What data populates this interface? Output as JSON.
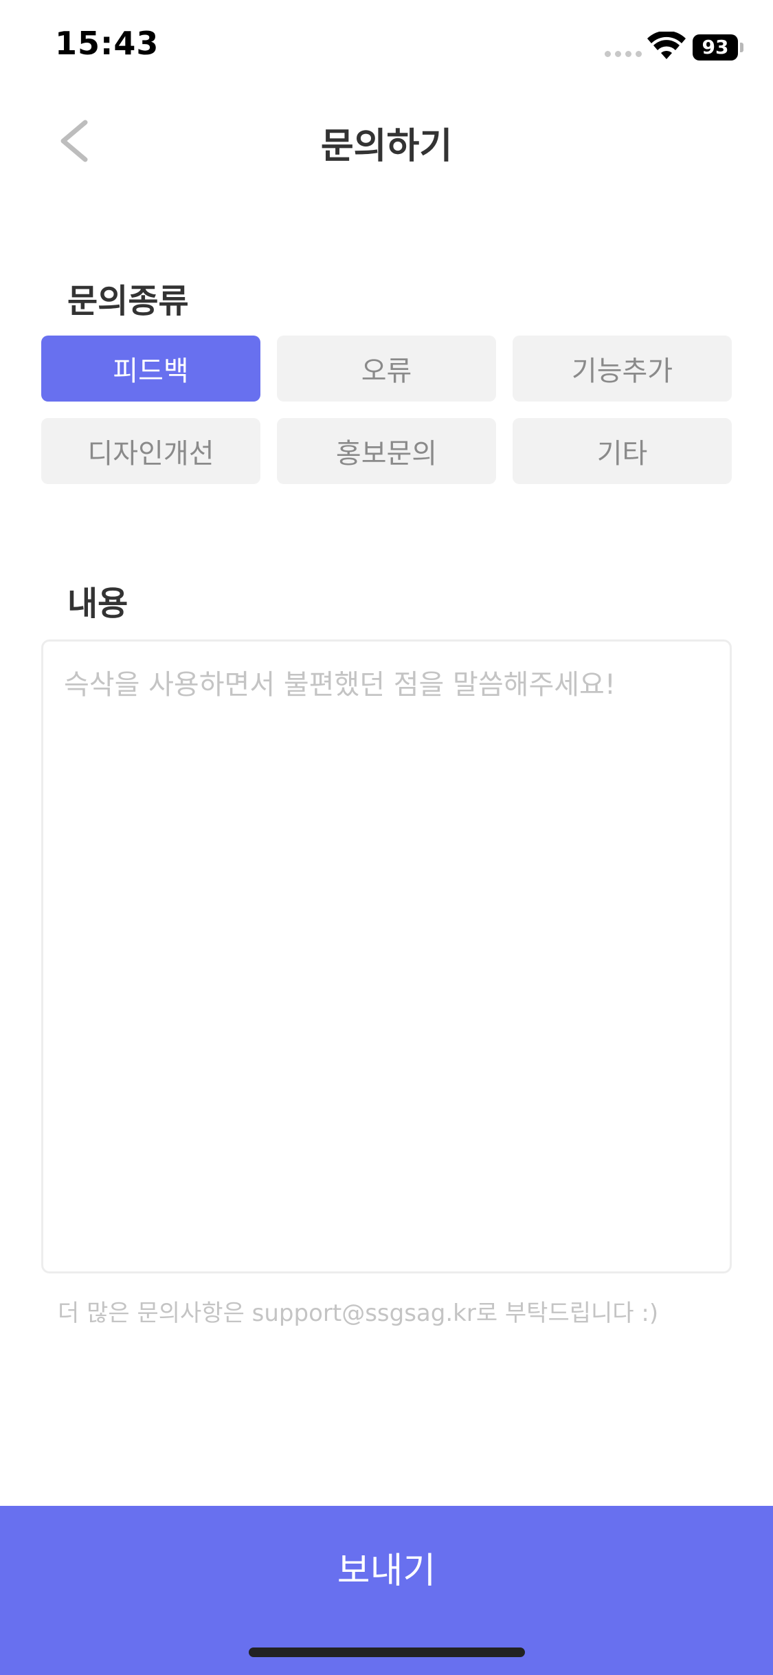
{
  "status_bar": {
    "time": "15:43",
    "battery_percent": "93",
    "icons": [
      "signal-icon",
      "wifi-icon",
      "battery-icon"
    ]
  },
  "header": {
    "title": "문의하기",
    "back_icon": "chevron-left-icon"
  },
  "inquiry_type": {
    "label": "문의종류",
    "selected": "피드백",
    "options": [
      "피드백",
      "오류",
      "기능추가",
      "디자인개선",
      "홍보문의",
      "기타"
    ]
  },
  "content": {
    "label": "내용",
    "value": "",
    "placeholder": "슥삭을 사용하면서 불편했던 점을 말씀해주세요!"
  },
  "helper_text": "더 많은 문의사항은 support@ssgsag.kr로 부탁드립니다 :)",
  "send_button": {
    "label": "보내기"
  },
  "colors": {
    "accent": "#6870ef",
    "chip_bg": "#f2f2f2",
    "chip_text": "#8a8a8a",
    "title_text": "#333333",
    "placeholder_text": "#c4c4c4"
  }
}
